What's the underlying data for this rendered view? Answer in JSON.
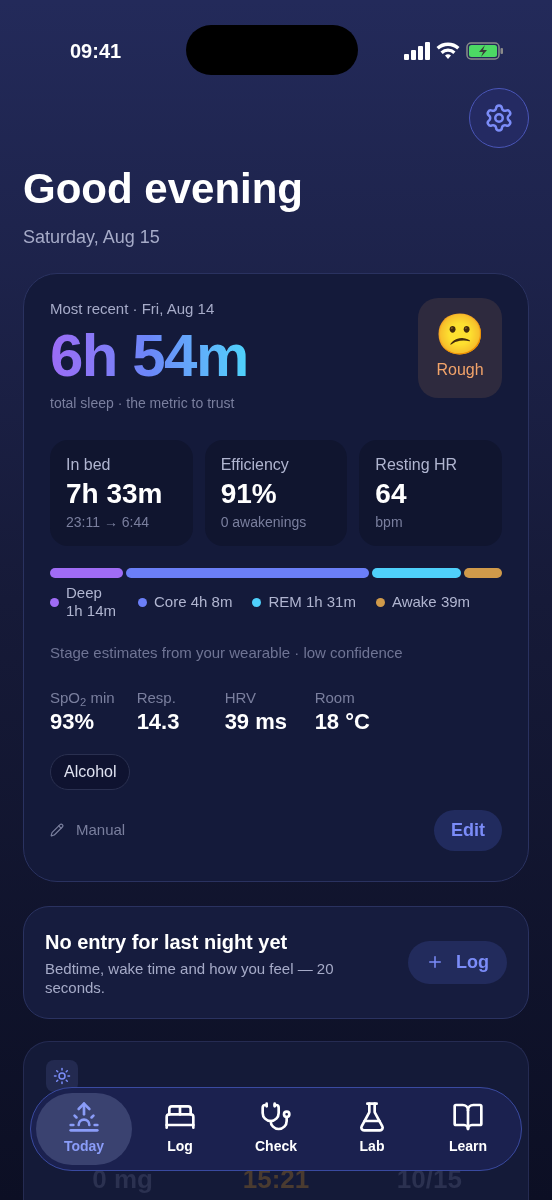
{
  "status_bar": {
    "time": "09:41"
  },
  "greeting": "Good evening",
  "date": "Saturday, Aug 15",
  "sleep_card": {
    "caption": "Most recent · Fri, Aug 14",
    "total": "6h 54m",
    "total_caption": "total sleep · the metric to trust",
    "mood": {
      "emoji": "😕",
      "label": "Rough"
    },
    "stats": [
      {
        "label": "In bed",
        "value": "7h 33m",
        "sub": "23:11 → 6:44"
      },
      {
        "label": "Efficiency",
        "value": "91%",
        "sub": "0 awakenings"
      },
      {
        "label": "Resting HR",
        "value": "64",
        "sub": "bpm"
      }
    ],
    "stages": [
      {
        "label": "Deep",
        "value": "1h 14m",
        "color": "#a06cf5"
      },
      {
        "label": "Core",
        "value": "4h 8m",
        "color": "#6b7ff8"
      },
      {
        "label": "REM",
        "value": "1h 31m",
        "color": "#4fd0fb"
      },
      {
        "label": "Awake",
        "value": "39m",
        "color": "#d09a4a"
      }
    ],
    "stage_note": "Stage estimates from your wearable · low confidence",
    "vitals": [
      {
        "label": "SpO$_{2}$ min",
        "value": "93%"
      },
      {
        "label": "Resp.",
        "value": "14.3"
      },
      {
        "label": "HRV",
        "value": "39 ms"
      },
      {
        "label": "Room",
        "value": "18 °C"
      }
    ],
    "tags": [
      "Alcohol"
    ],
    "source": "Manual",
    "edit_button": "Edit"
  },
  "prompt_card": {
    "title": "No entry for last night yet",
    "text": "Bedtime, wake time and how you feel — 20 seconds.",
    "button": "Log"
  },
  "today_card": {
    "values": [
      "0 mg",
      "15:21",
      "10/15"
    ]
  },
  "tab_bar": [
    {
      "label": "Today",
      "selected": true
    },
    {
      "label": "Log",
      "selected": false
    },
    {
      "label": "Check",
      "selected": false
    },
    {
      "label": "Lab",
      "selected": false
    },
    {
      "label": "Learn",
      "selected": false
    }
  ]
}
